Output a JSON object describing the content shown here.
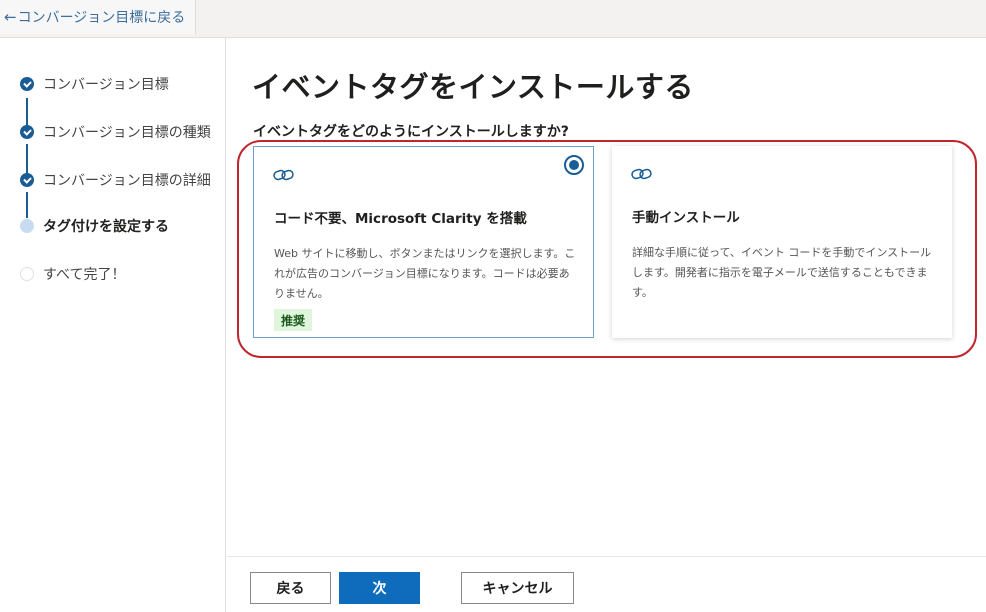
{
  "topbar": {
    "back_arrow": "←",
    "back_label": "コンバージョン目標に戻る"
  },
  "sidebar": {
    "steps": [
      {
        "label": "コンバージョン目標",
        "state": "done"
      },
      {
        "label": "コンバージョン目標の種類",
        "state": "done"
      },
      {
        "label": "コンバージョン目標の詳細",
        "state": "done"
      },
      {
        "label": "タグ付けを設定する",
        "state": "current"
      },
      {
        "label": "すべて完了！",
        "state": "pending"
      }
    ]
  },
  "main": {
    "title": "イベントタグをインストールする",
    "question": "イベントタグをどのようにインストールしますか?",
    "options": [
      {
        "icon": "link-icon",
        "title": "コード不要、Microsoft Clarity を搭載",
        "description": "Web サイトに移動し、ボタンまたはリンクを選択します。これが広告のコンバージョン目標になります。コードは必要ありません。",
        "badge": "推奨",
        "selected": true
      },
      {
        "icon": "link-icon",
        "title": "手動インストール",
        "description": "詳細な手順に従って、イベント コードを手動でインストールします。開発者に指示を電子メールで送信することもできます。",
        "selected": false
      }
    ]
  },
  "footer": {
    "back_label": "戻る",
    "next_label": "次",
    "cancel_label": "キャンセル"
  },
  "colors": {
    "accent": "#0f6cbd",
    "step_done": "#1a5c96",
    "highlight": "#c0262c",
    "badge_bg": "#dff6dd"
  }
}
